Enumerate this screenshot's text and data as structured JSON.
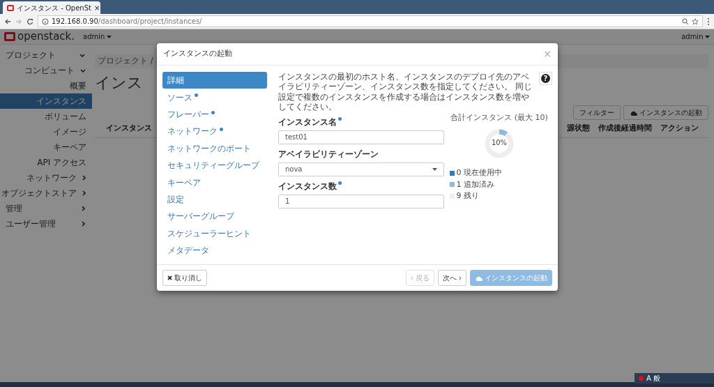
{
  "browser": {
    "tab_title": "インスタンス - OpenSt",
    "tab_close": "×",
    "url_host": "192.168.0.90",
    "url_path": "/dashboard/project/instances/"
  },
  "navbar": {
    "brand": "openstack.",
    "project": "admin",
    "user": "admin"
  },
  "sidebar": [
    {
      "label": "プロジェクト",
      "kind": "top",
      "selected": false,
      "expanded": true
    },
    {
      "label": "コンピュート",
      "kind": "sub",
      "selected": false,
      "expanded": true
    },
    {
      "label": "概要",
      "kind": "item",
      "selected": false
    },
    {
      "label": "インスタンス",
      "kind": "item",
      "selected": true
    },
    {
      "label": "ボリューム",
      "kind": "item",
      "selected": false
    },
    {
      "label": "イメージ",
      "kind": "item",
      "selected": false
    },
    {
      "label": "キーペア",
      "kind": "item",
      "selected": false
    },
    {
      "label": "API アクセス",
      "kind": "item",
      "selected": false
    },
    {
      "label": "ネットワーク",
      "kind": "sub",
      "selected": false,
      "expanded": false
    },
    {
      "label": "オブジェクトストア",
      "kind": "sub",
      "selected": false,
      "expanded": false
    },
    {
      "label": "管理",
      "kind": "top",
      "selected": false,
      "expanded": false
    },
    {
      "label": "ユーザー管理",
      "kind": "top",
      "selected": false,
      "expanded": false
    }
  ],
  "page": {
    "breadcrumb": "プロジェクト /",
    "heading": "インス",
    "filter_button": "フィルター",
    "launch_button": "インスタンスの起動",
    "columns": [
      {
        "label": "インスタンス"
      },
      {
        "label": "源状態"
      },
      {
        "label": "作成後経過時間"
      },
      {
        "label": "アクション"
      }
    ]
  },
  "modal": {
    "title": "インスタンスの起動",
    "close": "×",
    "steps": [
      {
        "label": "詳細",
        "selected": true,
        "required": false
      },
      {
        "label": "ソース",
        "selected": false,
        "required": true
      },
      {
        "label": "フレーバー",
        "selected": false,
        "required": true
      },
      {
        "label": "ネットワーク",
        "selected": false,
        "required": true
      },
      {
        "label": "ネットワークのポート",
        "selected": false,
        "required": false
      },
      {
        "label": "セキュリティーグループ",
        "selected": false,
        "required": false
      },
      {
        "label": "キーペア",
        "selected": false,
        "required": false
      },
      {
        "label": "設定",
        "selected": false,
        "required": false
      },
      {
        "label": "サーバーグループ",
        "selected": false,
        "required": false
      },
      {
        "label": "スケジューラーヒント",
        "selected": false,
        "required": false
      },
      {
        "label": "メタデータ",
        "selected": false,
        "required": false
      }
    ],
    "description": "インスタンスの最初のホスト名、インスタンスのデプロイ先のアベイラビリティーゾーン、インスタンス数を指定してください。 同じ設定で複数のインスタンスを作成する場合はインスタンス数を増やしてください。",
    "help": "?",
    "fields": [
      {
        "label": "インスタンス名",
        "required": true,
        "kind": "text",
        "value": "test01"
      },
      {
        "label": "アベイラビリティーゾーン",
        "required": false,
        "kind": "select",
        "value": "nova"
      },
      {
        "label": "インスタンス数",
        "required": true,
        "kind": "text",
        "value": "1"
      }
    ],
    "quota": {
      "title": "合計インスタンス (最大 10)",
      "level": 0.1,
      "reading": "10%",
      "legend": [
        {
          "label": "0 現在使用中",
          "color": "#337ab7"
        },
        {
          "label": "1 追加済み",
          "color": "#8fb8de"
        },
        {
          "label": "9 残り",
          "color": "#eeeeee"
        }
      ]
    },
    "buttons": [
      {
        "label": "取り消し",
        "kind": "cancel",
        "disabled": false
      },
      {
        "label": "‹ 戻る",
        "kind": "back",
        "disabled": true
      },
      {
        "label": "次へ ›",
        "kind": "next",
        "disabled": false
      },
      {
        "label": "インスタンスの起動",
        "kind": "launch",
        "disabled": true
      }
    ]
  },
  "tray": {
    "ime": "A 般"
  }
}
